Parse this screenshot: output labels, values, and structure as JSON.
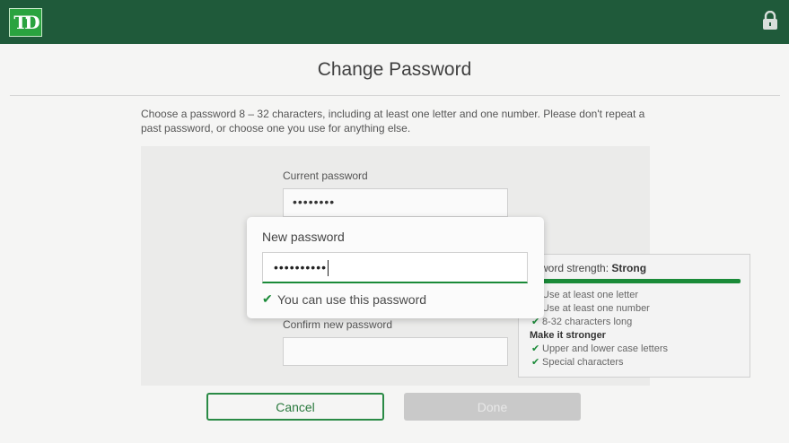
{
  "header": {
    "logo_text": "TD",
    "lock_icon": "lock-icon"
  },
  "page": {
    "title": "Change Password",
    "instructions": "Choose a password 8 – 32 characters, including at least one letter and one number. Please don't repeat a past password, or choose one you use for anything else."
  },
  "form": {
    "current_password_label": "Current password",
    "current_password_value": "••••••••",
    "confirm_password_label": "Confirm new password",
    "confirm_password_value": ""
  },
  "strength": {
    "label": "ssword strength:",
    "level": "Strong",
    "level_fraction": 1.0,
    "requirements": [
      {
        "text": "Use at least one letter",
        "met": true
      },
      {
        "text": "Use at least one number",
        "met": true
      },
      {
        "text": "8-32 characters long",
        "met": true
      }
    ],
    "stronger_heading": "Make it stronger",
    "stronger": [
      {
        "text": "Upper and lower case letters",
        "met": true
      },
      {
        "text": "Special characters",
        "met": true
      }
    ]
  },
  "popup": {
    "label": "New password",
    "value": "••••••••••",
    "message": "You can use this password"
  },
  "buttons": {
    "cancel": "Cancel",
    "done": "Done"
  },
  "colors": {
    "header": "#1f5a3a",
    "accent": "#1a8a38",
    "logo": "#2aa33f"
  }
}
